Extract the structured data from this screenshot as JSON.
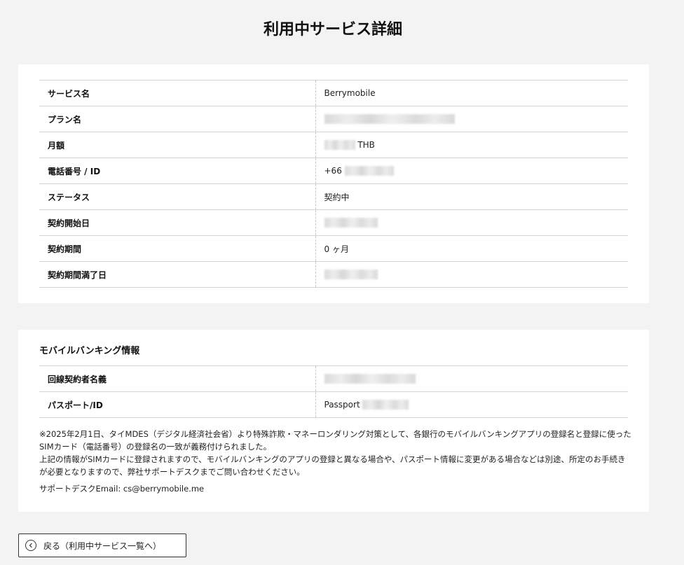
{
  "page": {
    "title": "利用中サービス詳細"
  },
  "service_details": {
    "rows": [
      {
        "label": "サービス名",
        "value": "Berrymobile"
      },
      {
        "label": "プラン名",
        "value": ""
      },
      {
        "label": "月額",
        "value": "",
        "suffix": "THB"
      },
      {
        "label": "電話番号 / ID",
        "value": "+66"
      },
      {
        "label": "ステータス",
        "value": "契約中"
      },
      {
        "label": "契約開始日",
        "value": ""
      },
      {
        "label": "契約期間",
        "value": "0 ヶ月"
      },
      {
        "label": "契約期間満了日",
        "value": ""
      }
    ]
  },
  "mobile_banking": {
    "title": "モバイルバンキング情報",
    "rows": [
      {
        "label": "回線契約者名義",
        "value": ""
      },
      {
        "label": "パスポート/ID",
        "value": "Passport"
      }
    ],
    "notice_line1": "※2025年2月1日、タイMDES（デジタル経済社会省）より特殊詐欺・マネーロンダリング対策として、各銀行のモバイルバンキングアプリの登録名と登録に使ったSIMカード（電話番号）の登録名の一致が義務付けられました。",
    "notice_line2": "上記の情報がSIMカードに登録されますので、モバイルバンキングのアプリの登録と異なる場合や、パスポート情報に変更がある場合などは別途、所定のお手続きが必要となりますので、弊社サポートデスクまでご問い合わせください。",
    "support": "サポートデスクEmail: cs@berrymobile.me"
  },
  "back_button": {
    "label": "戻る（利用中サービス一覧へ）",
    "icon": "chevron-left-circle-icon"
  }
}
